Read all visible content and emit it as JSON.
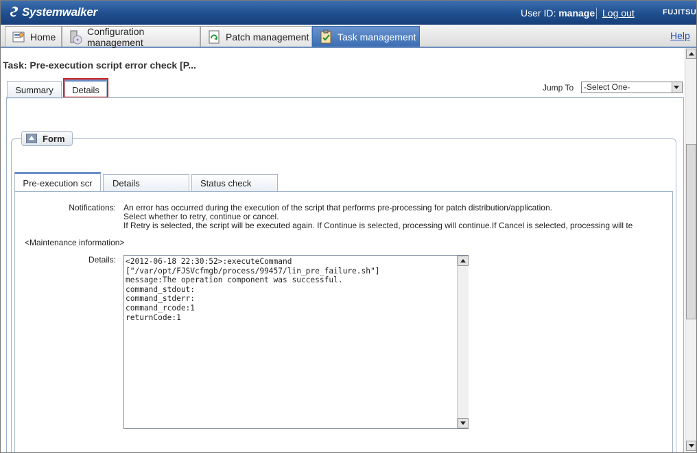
{
  "header": {
    "brand": "Systemwalker",
    "user_label": "User ID:",
    "user_id": "manage",
    "logout": "Log out",
    "vendor": "FUJITSU"
  },
  "nav": {
    "tabs": [
      {
        "label": "Home",
        "icon": "home-icon"
      },
      {
        "label": "Configuration management",
        "icon": "server-cd-icon"
      },
      {
        "label": "Patch management",
        "icon": "patch-icon"
      },
      {
        "label": "Task management",
        "icon": "clipboard-check-icon",
        "active": true
      }
    ],
    "help": "Help"
  },
  "page": {
    "title": "Task: Pre-execution script error check [P...",
    "tabs": [
      "Summary",
      "Details"
    ],
    "selected_tab": "Details",
    "jump_to_label": "Jump To",
    "jump_to_value": "-Select One-"
  },
  "form": {
    "legend": "Form",
    "tabs": [
      "Pre-execution scr",
      "Details",
      "Status check"
    ],
    "selected_tab": "Pre-execution scr",
    "notifications_label": "Notifications:",
    "notifications_lines": [
      "An error has occurred during the execution of the script that performs pre-processing for patch distribution/application.",
      "Select whether to retry, continue or cancel.",
      "If Retry is selected, the script will be executed again. If Continue is selected, processing will continue.If Cancel is selected, processing will te"
    ],
    "maintenance_heading": "<Maintenance information>",
    "details_label": "Details:",
    "details_text": "<2012-06-18 22:30:52>:executeCommand\n[\"/var/opt/FJSVcfmgb/process/99457/lin_pre_failure.sh\"]\nmessage:The operation component was successful.\ncommand_stdout:\ncommand_stderr:\ncommand_rcode:1\nreturnCode:1"
  },
  "colors": {
    "header_blue": "#1f4e8e",
    "active_tab": "#3a6db3",
    "highlight_red": "#d42020"
  }
}
